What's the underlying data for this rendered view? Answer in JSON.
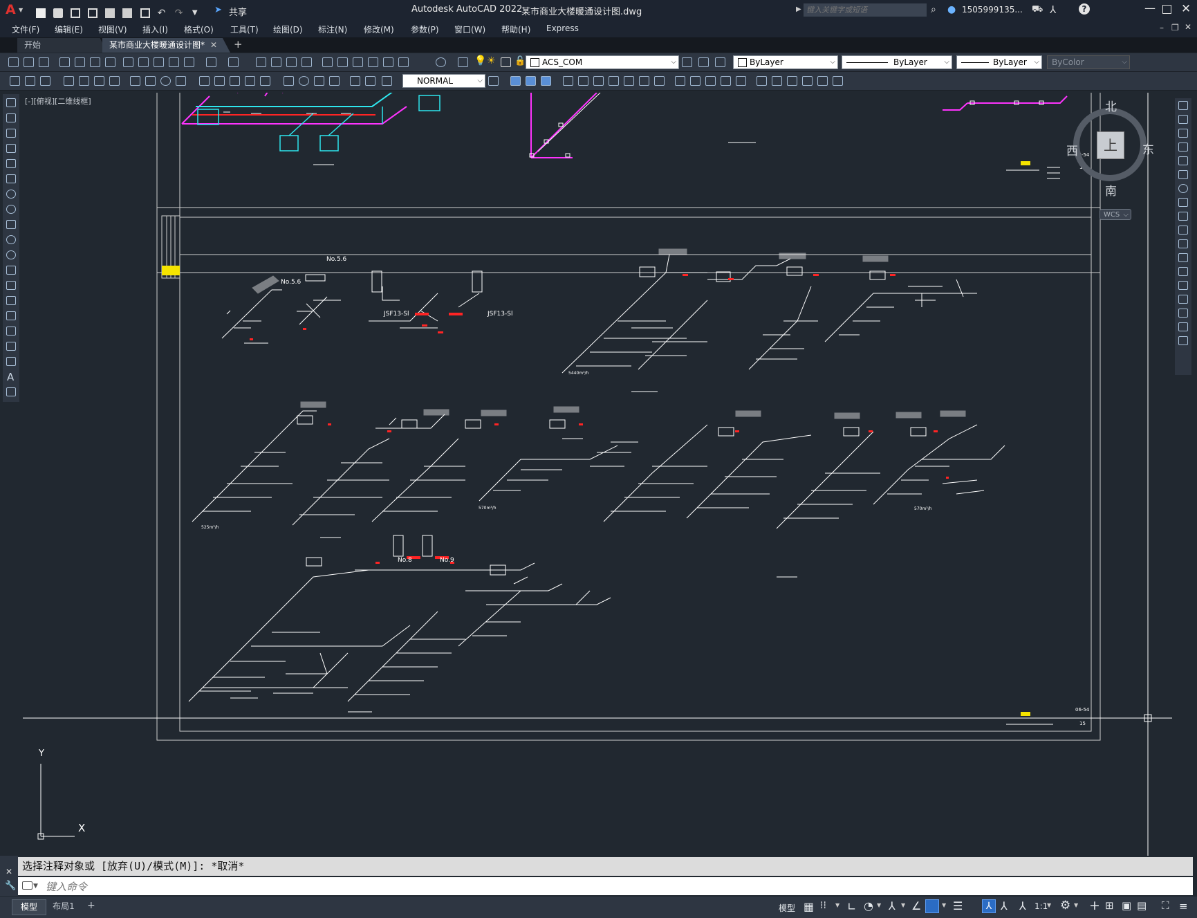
{
  "app": {
    "logo": "A",
    "title": "Autodesk AutoCAD 2022",
    "filename": "某市商业大楼暖通设计图.dwg",
    "share_label": "共享",
    "search_placeholder": "键入关键字或短语",
    "user": "1505999135...",
    "help_icon": "question-icon"
  },
  "menu": [
    "文件(F)",
    "编辑(E)",
    "视图(V)",
    "插入(I)",
    "格式(O)",
    "工具(T)",
    "绘图(D)",
    "标注(N)",
    "修改(M)",
    "参数(P)",
    "窗口(W)",
    "帮助(H)",
    "Express"
  ],
  "tabs": {
    "start": "开始",
    "active": "某市商业大楼暖通设计图*",
    "add": "+"
  },
  "toolbar": {
    "layer": "ACS_COM",
    "color": "ByLayer",
    "linetype": "ByLayer",
    "lineweight": "ByLayer",
    "plotstyle": "ByColor",
    "dimstyle": "NORMAL"
  },
  "viewport": {
    "label": "[-][俯视][二维线框]"
  },
  "viewcube": {
    "north": "北",
    "south": "南",
    "east": "东",
    "west": "西",
    "face": "上",
    "wcs": "WCS"
  },
  "ucs": {
    "x": "X",
    "y": "Y"
  },
  "drawing": {
    "sheet_code": "06-54",
    "sheet_num": "15",
    "fan_label_1": "No.5.6",
    "fan_label_2": "No.5.6",
    "fan_label_3": "JSF13-Sl",
    "fan_label_4": "JSF13-Sl",
    "fan_label_5": "No.8",
    "fan_label_6": "No.9",
    "flow_1": "5440m³/h",
    "flow_2": "525m³/h",
    "flow_3": "570m³/h",
    "flow_4": "570m³/h"
  },
  "command": {
    "history": "选择注释对象或 [放弃(U)/模式(M)]: *取消*",
    "placeholder": "键入命令"
  },
  "status": {
    "model_tab": "模型",
    "layout_tab": "布局1",
    "add": "+",
    "model_btn": "模型",
    "scale": "1:1"
  },
  "colors": {
    "canvas": "#212830",
    "chrome": "#2e3642",
    "accent": "#3a8ee6"
  }
}
